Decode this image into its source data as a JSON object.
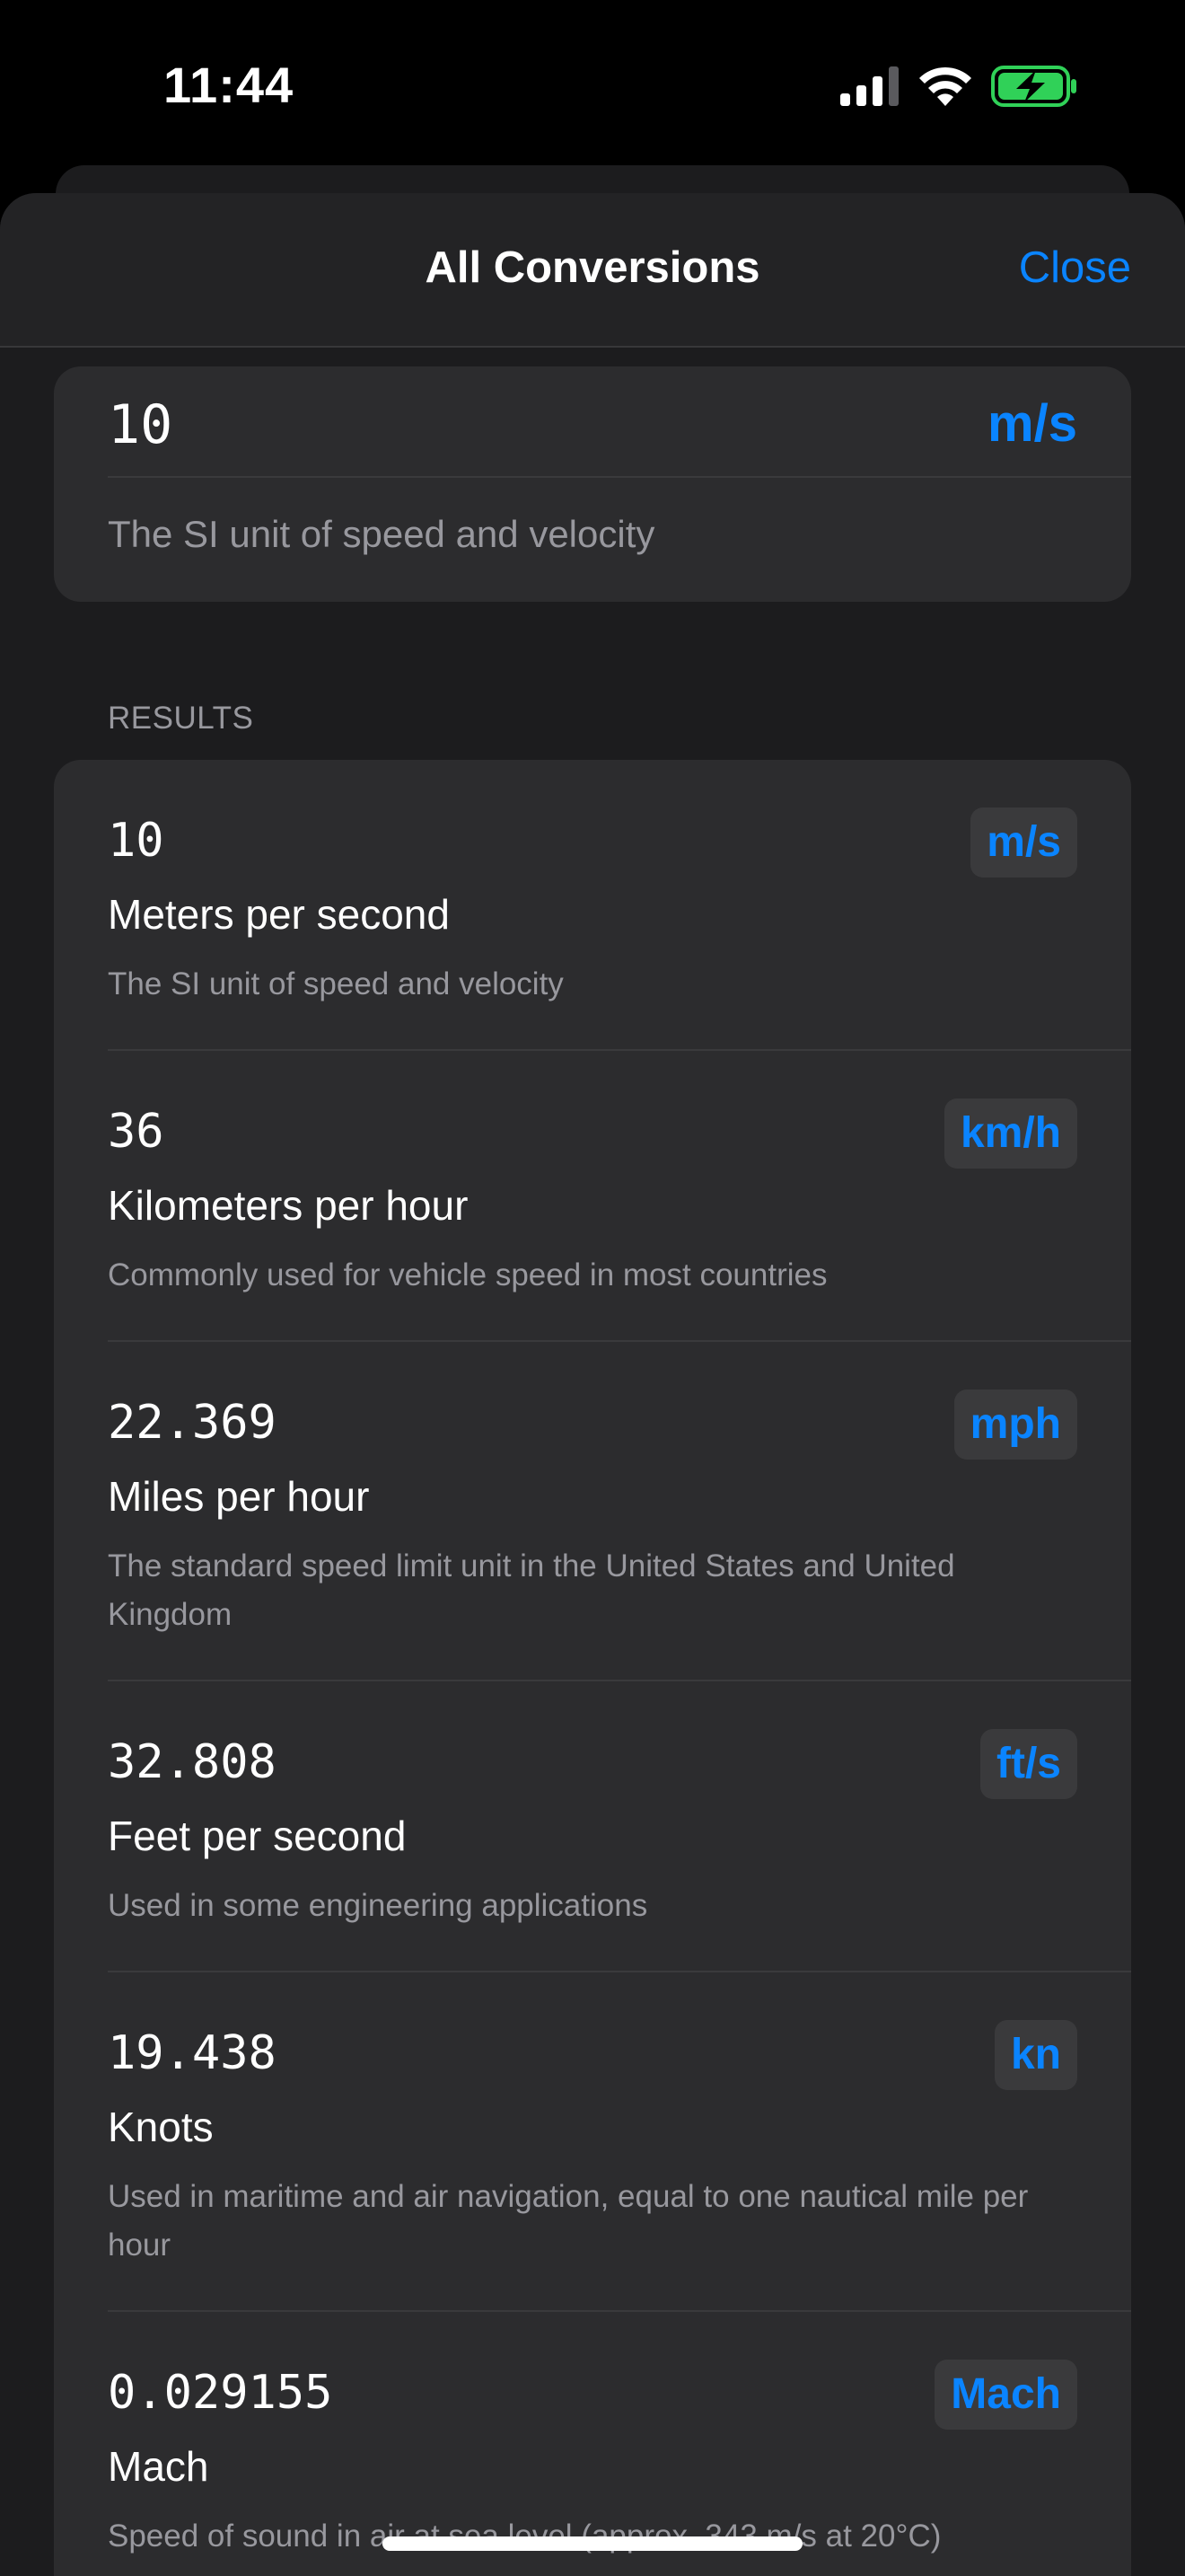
{
  "status_bar": {
    "time": "11:44",
    "icons": [
      "cellular-signal-icon",
      "wifi-icon",
      "battery-charging-icon"
    ]
  },
  "nav": {
    "title": "All Conversions",
    "close_label": "Close"
  },
  "input": {
    "value": "10",
    "unit": "m/s",
    "description": "The SI unit of speed and velocity"
  },
  "results": {
    "header": "RESULTS",
    "items": [
      {
        "value": "10",
        "unit": "m/s",
        "name": "Meters per second",
        "description": "The SI unit of speed and velocity"
      },
      {
        "value": "36",
        "unit": "km/h",
        "name": "Kilometers per hour",
        "description": "Commonly used for vehicle speed in most countries"
      },
      {
        "value": "22.369",
        "unit": "mph",
        "name": "Miles per hour",
        "description": "The standard speed limit unit in the United States and United Kingdom"
      },
      {
        "value": "32.808",
        "unit": "ft/s",
        "name": "Feet per second",
        "description": "Used in some engineering applications"
      },
      {
        "value": "19.438",
        "unit": "kn",
        "name": "Knots",
        "description": "Used in maritime and air navigation, equal to one nautical mile per hour"
      },
      {
        "value": "0.029155",
        "unit": "Mach",
        "name": "Mach",
        "description": "Speed of sound in air at sea level (approx. 343 m/s at 20°C)"
      }
    ]
  },
  "colors": {
    "accent": "#0a84ff",
    "background": "#1c1c1e",
    "card": "#2c2c2e",
    "secondary_text": "#98989e",
    "battery": "#30d158"
  }
}
